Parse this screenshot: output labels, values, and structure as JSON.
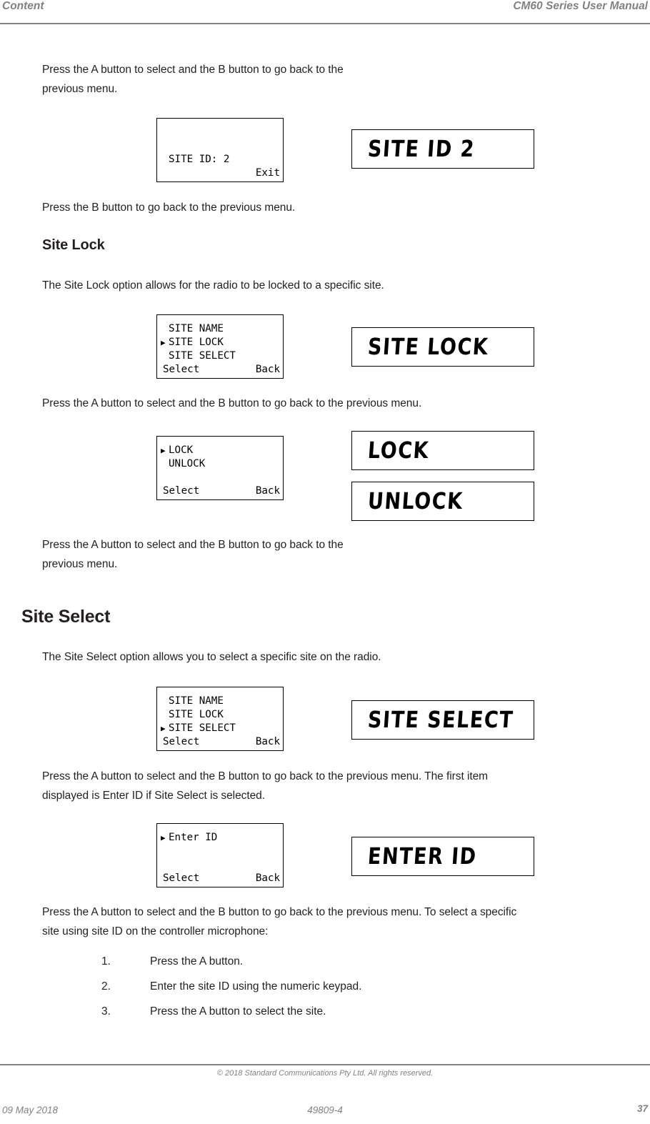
{
  "header": {
    "left": "Content",
    "right": "CM60 Series User Manual"
  },
  "body": {
    "para1_line1": "Press the A button to select and the B button to go back to the",
    "para1_line2": "previous menu.",
    "para2": "Press the B button to go back to the previous menu.",
    "heading_site_lock": "Site Lock",
    "para3": "The Site Lock option allows for the radio to be locked to a specific site.",
    "para4": "Press the A button to select and the B button to go back to the previous menu.",
    "para5_line1": "Press the A button to select and the B button to go back to the",
    "para5_line2": "previous menu.",
    "heading_site_select": "Site Select",
    "para6": "The Site Select option allows you to select a specific site on the radio.",
    "para7_line1": "Press the A button to select and the B button to go back to the previous menu. The first item",
    "para7_line2": "displayed is Enter ID if Site Select is selected.",
    "para8_line1": "Press the A button to select and the B button to go back to the previous menu. To select a specific",
    "para8_line2": "site using site ID on the controller microphone:"
  },
  "steps": [
    {
      "num": "1.",
      "text": "Press the A button."
    },
    {
      "num": "2.",
      "text": "Enter the site ID using the numeric keypad."
    },
    {
      "num": "3.",
      "text": "Press the A button to select the site."
    }
  ],
  "cursor_glyph": "▶",
  "screens": {
    "site_id": {
      "rows": [
        {
          "cursor": "",
          "label": "",
          "right": ""
        },
        {
          "cursor": "",
          "label": "",
          "right": ""
        },
        {
          "cursor": "",
          "label": "SITE ID: 2",
          "right": ""
        },
        {
          "cursor": "",
          "label": "",
          "right": "Exit"
        }
      ]
    },
    "site_lock_menu": {
      "rows": [
        {
          "cursor": "",
          "label": "SITE NAME",
          "right": ""
        },
        {
          "cursor": "▶",
          "label": "SITE LOCK",
          "right": ""
        },
        {
          "cursor": "",
          "label": "SITE SELECT",
          "right": ""
        },
        {
          "cursor": "",
          "label": "Select",
          "right": "Back"
        }
      ]
    },
    "lock_menu": {
      "rows": [
        {
          "cursor": "▶",
          "label": "LOCK",
          "right": ""
        },
        {
          "cursor": "",
          "label": "UNLOCK",
          "right": ""
        },
        {
          "cursor": "",
          "label": "",
          "right": ""
        },
        {
          "cursor": "",
          "label": "Select",
          "right": "Back"
        }
      ]
    },
    "site_select_menu": {
      "rows": [
        {
          "cursor": "",
          "label": "SITE NAME",
          "right": ""
        },
        {
          "cursor": "",
          "label": "SITE LOCK",
          "right": ""
        },
        {
          "cursor": "▶",
          "label": "SITE SELECT",
          "right": ""
        },
        {
          "cursor": "",
          "label": "Select",
          "right": "Back"
        }
      ]
    },
    "enter_id_menu": {
      "rows": [
        {
          "cursor": "▶",
          "label": "Enter ID",
          "right": ""
        },
        {
          "cursor": "",
          "label": "",
          "right": ""
        },
        {
          "cursor": "",
          "label": "",
          "right": ""
        },
        {
          "cursor": "",
          "label": "Select",
          "right": "Back"
        }
      ]
    }
  },
  "lcd": {
    "site_id_2": "SITE ID 2",
    "site_lock": "SITE LOCK",
    "lock": "LOCK",
    "unlock": "UNLOCK",
    "site_select": "SITE SELECT",
    "enter_id": "ENTER ID"
  },
  "footer": {
    "copyright": "© 2018 Standard Communications Pty Ltd. All rights reserved.",
    "date": "09 May 2018",
    "doc_number": "49809-4",
    "page_number": "37"
  },
  "colors": {
    "gray": "#808285",
    "ink": "#231f20"
  }
}
